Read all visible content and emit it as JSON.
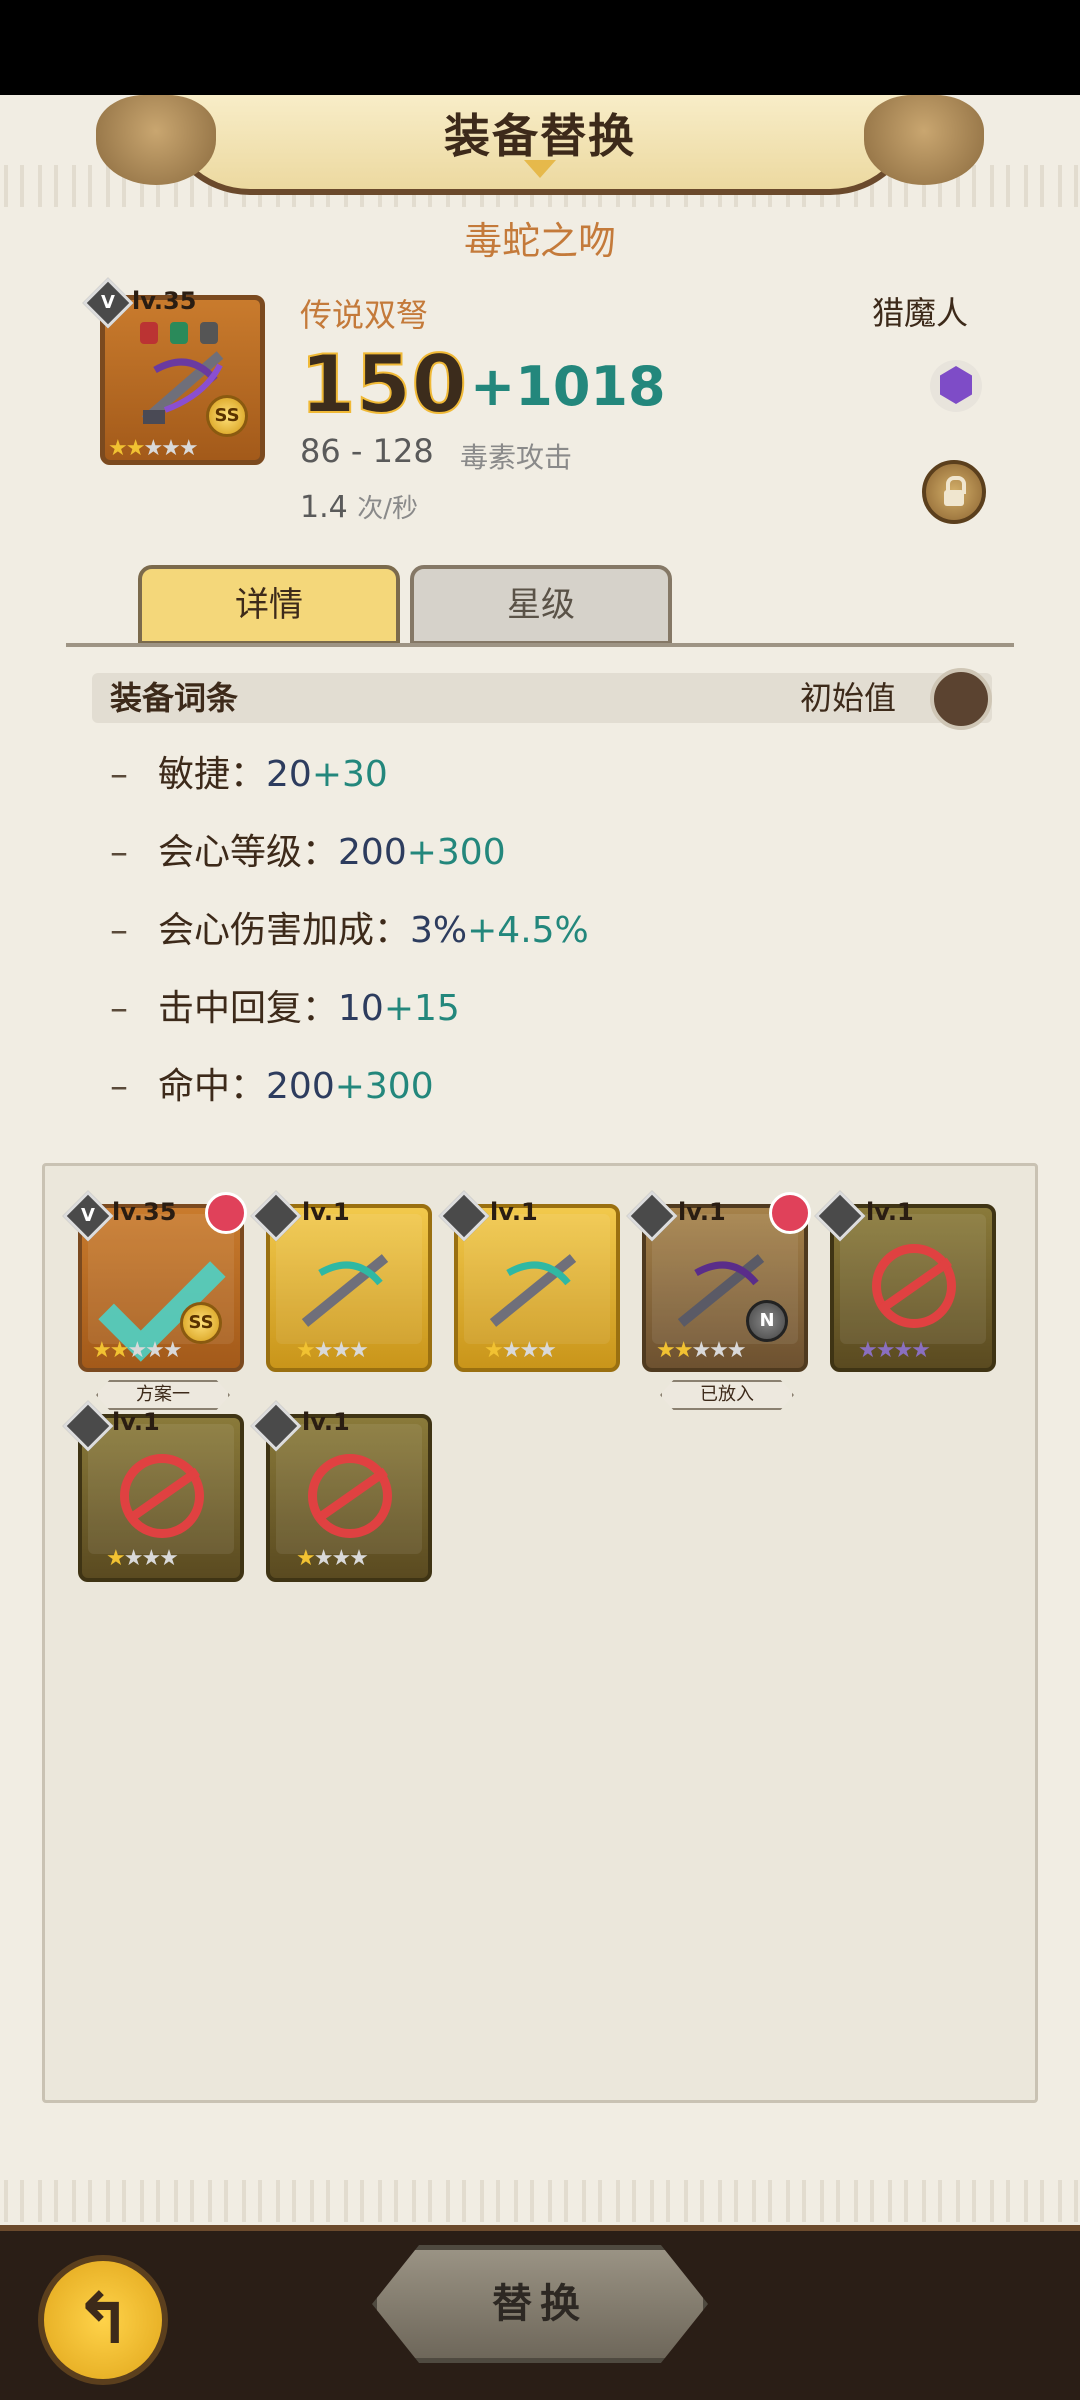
{
  "header": {
    "title": "装备替换"
  },
  "item": {
    "name": "毒蛇之吻",
    "type": "传说双弩",
    "class": "猎魔人",
    "level": "lv.35",
    "rank": "V",
    "grade_badge": "SS",
    "stars": [
      true,
      true,
      false,
      false,
      false
    ],
    "attack": "150",
    "attack_bonus": "+1018",
    "range": "86 - 128",
    "damage_type": "毒素攻击",
    "speed_value": "1.4",
    "speed_unit": "次/秒"
  },
  "tabs": [
    {
      "label": "详情",
      "active": true
    },
    {
      "label": "星级",
      "active": false
    }
  ],
  "stats_section": {
    "title": "装备词条",
    "toggle_label": "初始值",
    "attributes": [
      {
        "label": "敏捷：",
        "base": "20",
        "bonus": "+30"
      },
      {
        "label": "会心等级：",
        "base": "200",
        "bonus": "+300"
      },
      {
        "label": "会心伤害加成：",
        "base": "3%",
        "bonus": "+4.5%"
      },
      {
        "label": "击中回复：",
        "base": "10",
        "bonus": "+15"
      },
      {
        "label": "命中：",
        "base": "200",
        "bonus": "+300"
      }
    ]
  },
  "inventory": {
    "slots": [
      {
        "level": "lv.35",
        "rank": "V",
        "style": "legend",
        "checked": true,
        "tag": "方案一",
        "badge": "SS",
        "stars": 2,
        "avatar": true
      },
      {
        "level": "lv.1",
        "style": "gold",
        "stars": 1,
        "unusable": false
      },
      {
        "level": "lv.1",
        "style": "gold",
        "stars": 1,
        "unusable": false
      },
      {
        "level": "lv.1",
        "style": "brown",
        "stars": 2,
        "tag": "已放入",
        "badge": "N",
        "avatar": true
      },
      {
        "level": "lv.1",
        "style": "dark",
        "stars": 0,
        "unusable": true
      },
      {
        "level": "lv.1",
        "style": "dark",
        "stars": 1,
        "unusable": true
      },
      {
        "level": "lv.1",
        "style": "dark",
        "stars": 1,
        "unusable": true
      }
    ]
  },
  "footer": {
    "replace_label": "替换",
    "back_icon": "back-arrow-icon"
  }
}
